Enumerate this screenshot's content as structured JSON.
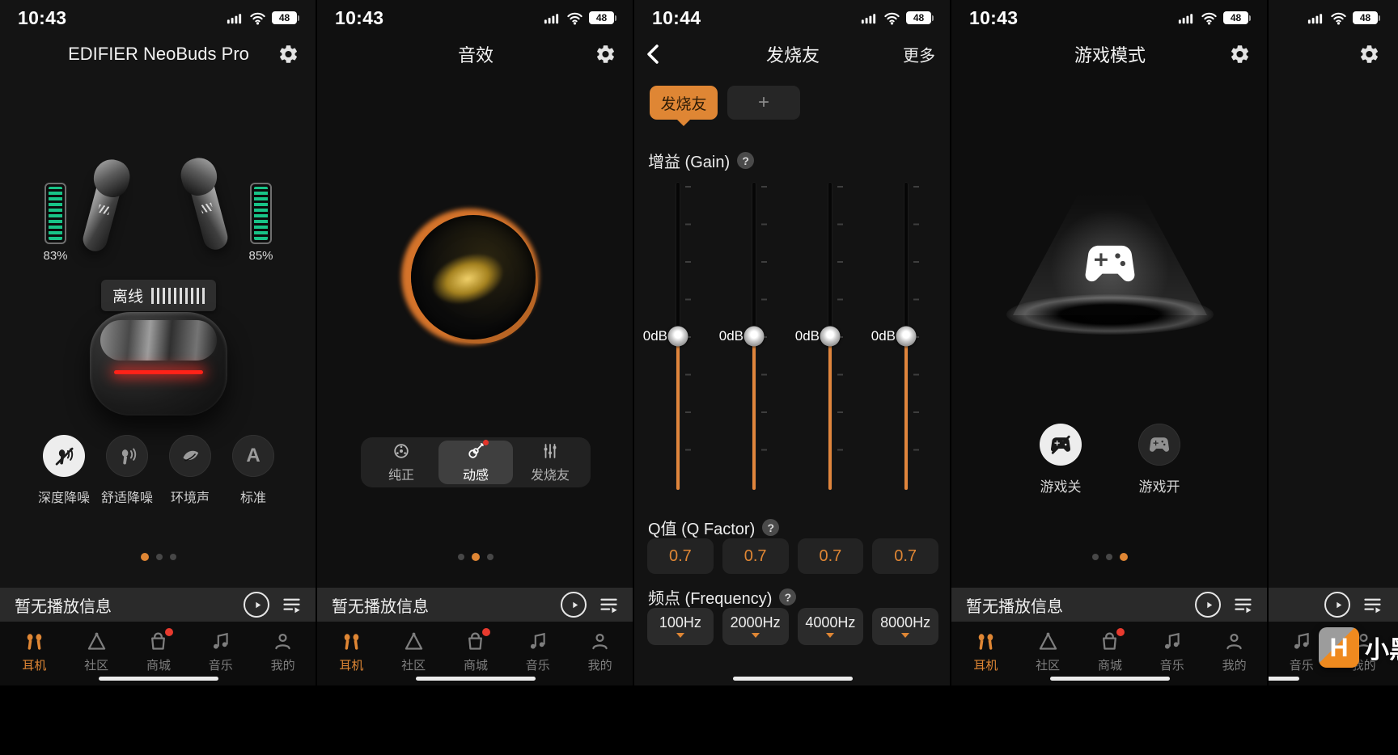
{
  "accent": "#df8634",
  "status": {
    "times": [
      "10:43",
      "10:43",
      "10:44",
      "10:43"
    ],
    "battery_level": "48"
  },
  "tabbar": {
    "items": [
      {
        "label": "耳机"
      },
      {
        "label": "社区"
      },
      {
        "label": "商城"
      },
      {
        "label": "音乐"
      },
      {
        "label": "我的"
      }
    ]
  },
  "now_playing": {
    "text": "暂无播放信息"
  },
  "screen1": {
    "title": "EDIFIER NeoBuds Pro",
    "left_battery": "83%",
    "right_battery": "85%",
    "case_status": "离线",
    "standard_icon_letter": "A",
    "noise_modes": [
      {
        "label": "深度降噪"
      },
      {
        "label": "舒适降噪"
      },
      {
        "label": "环境声"
      },
      {
        "label": "标准"
      }
    ]
  },
  "screen2": {
    "title": "音效",
    "presets": [
      {
        "label": "纯正"
      },
      {
        "label": "动感"
      },
      {
        "label": "发烧友"
      }
    ]
  },
  "screen3": {
    "title": "发烧友",
    "more_label": "更多",
    "preset_tab": "发烧友",
    "add_tab": "+",
    "help_glyph": "?",
    "gain": {
      "label": "增益 (Gain)",
      "values": [
        "0dB",
        "0dB",
        "0dB",
        "0dB"
      ]
    },
    "q_factor": {
      "label": "Q值 (Q Factor)",
      "values": [
        "0.7",
        "0.7",
        "0.7",
        "0.7"
      ]
    },
    "frequency": {
      "label": "频点 (Frequency)",
      "values": [
        "100Hz",
        "2000Hz",
        "4000Hz",
        "8000Hz"
      ]
    }
  },
  "screen4": {
    "title": "游戏模式",
    "modes": [
      {
        "label": "游戏关"
      },
      {
        "label": "游戏开"
      }
    ]
  },
  "watermark": {
    "text": "小黑盒",
    "logo_letter": "H"
  }
}
